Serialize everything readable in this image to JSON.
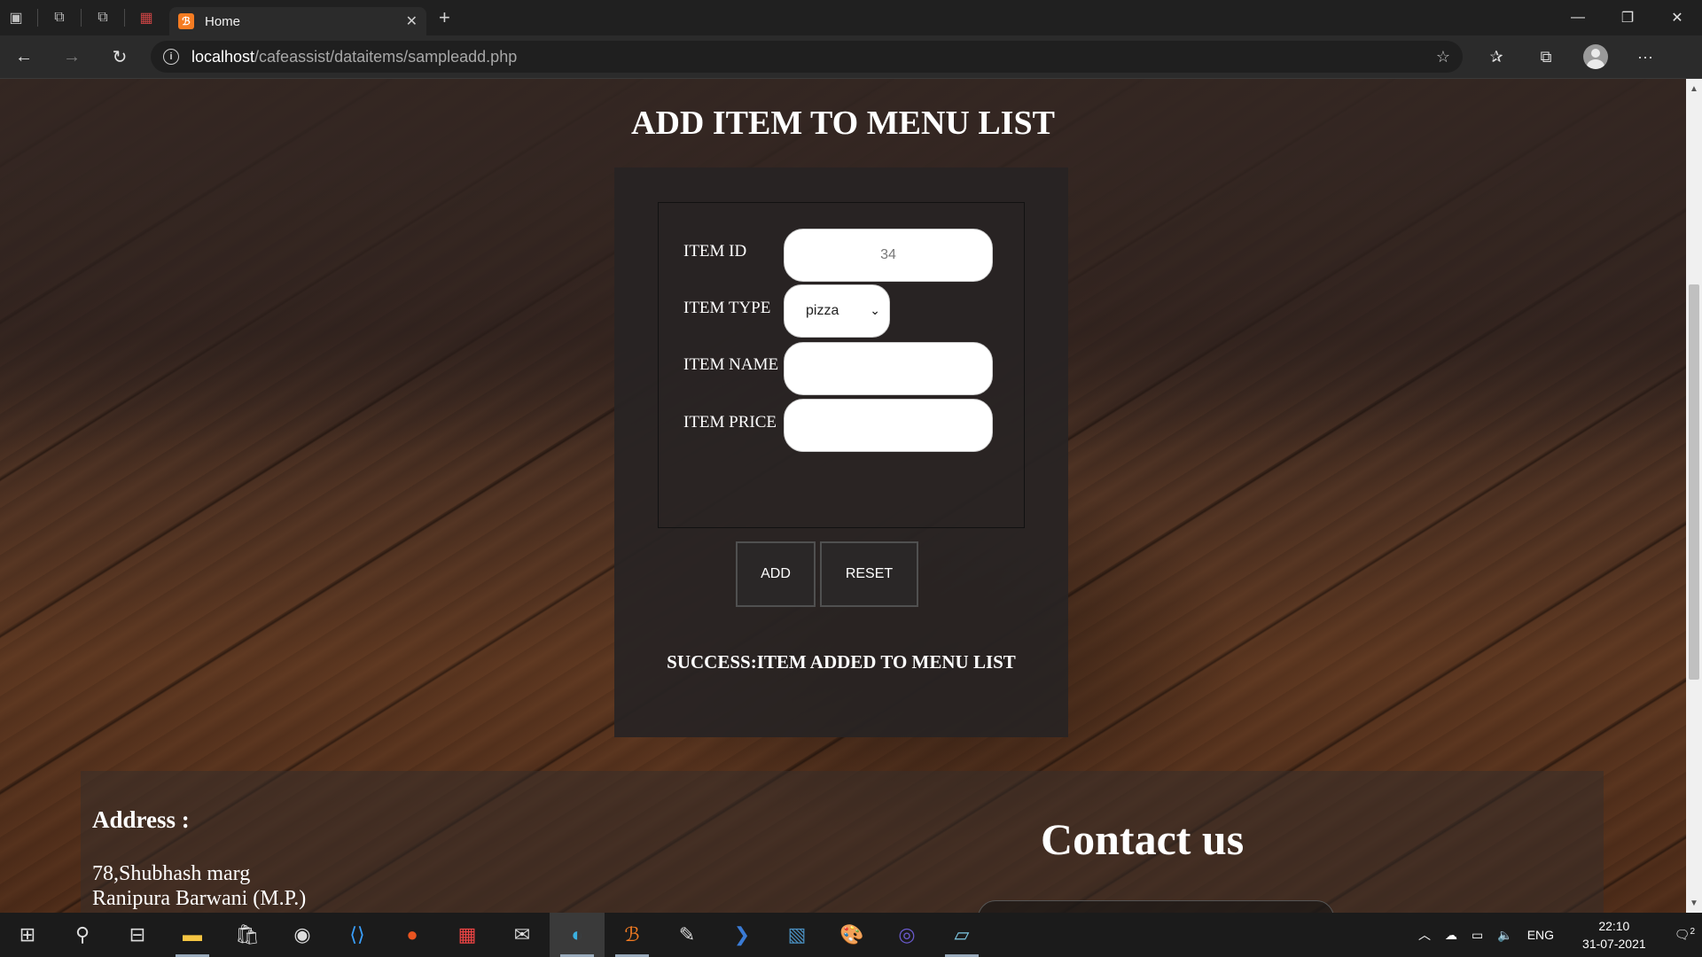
{
  "browser": {
    "tab_title": "Home",
    "url_host": "localhost",
    "url_path": "/cafeassist/dataitems/sampleadd.php"
  },
  "page": {
    "title": "ADD ITEM TO MENU LIST",
    "form": {
      "item_id_label": "ITEM ID",
      "item_id_value": "34",
      "item_type_label": "ITEM TYPE",
      "item_type_value": "pizza",
      "item_name_label": "ITEM NAME",
      "item_name_value": "",
      "item_price_label": "ITEM PRICE",
      "item_price_value": ""
    },
    "buttons": {
      "add": "ADD",
      "reset": "RESET"
    },
    "status_message": "SUCCESS:ITEM ADDED TO MENU LIST",
    "footer": {
      "address_heading": "Address :",
      "address_line1": "78,Shubhash marg",
      "address_line2": "Ranipura Barwani (M.P.)",
      "contact_heading": "Contact us"
    }
  },
  "taskbar": {
    "language": "ENG",
    "time": "22:10",
    "date": "31-07-2021",
    "notification_count": "2"
  }
}
